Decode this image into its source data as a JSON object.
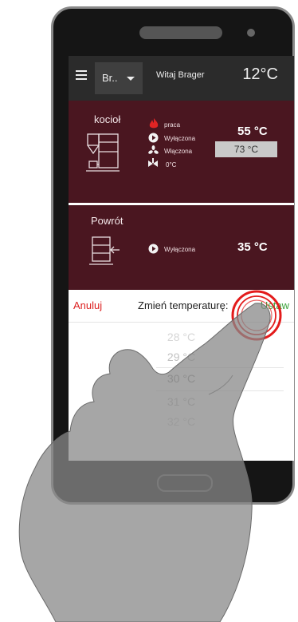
{
  "header": {
    "menu_icon": "hamburger-icon",
    "dropdown_label": "Br..",
    "greeting": "Witaj Brager",
    "outdoor_temp": "12°C"
  },
  "boiler": {
    "title": "kocioł",
    "status_work": "praca",
    "pump_state": "Wyłączona",
    "fan_state": "Włączona",
    "valve_value": "0°C",
    "current_temp": "55 °C",
    "set_temp": "73 °C"
  },
  "return": {
    "title": "Powrót",
    "pump_state": "Wyłączona",
    "temp": "35 °C"
  },
  "picker": {
    "cancel_label": "Anuluj",
    "title": "Zmień temperaturę:",
    "set_label": "Ustaw",
    "options": [
      "28 °C",
      "29 °C",
      "30 °C",
      "31 °C",
      "32 °C"
    ]
  },
  "colors": {
    "card_bg": "#4a1620",
    "appbar_bg": "#2b2b2b",
    "cancel": "#dd2222",
    "set": "#3aa33a",
    "tap_ring": "#e31b1b"
  }
}
